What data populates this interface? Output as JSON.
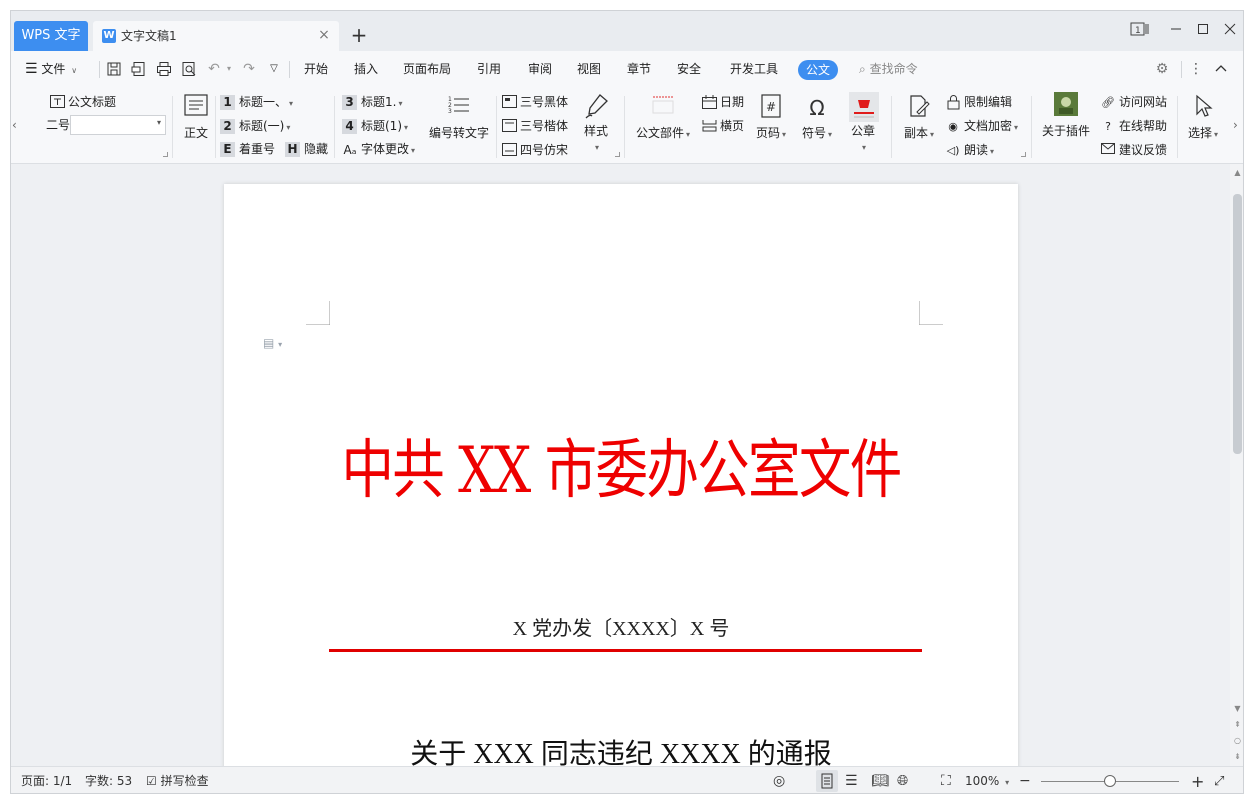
{
  "tabs": {
    "app_label": "WPS 文字",
    "doc_label": "文字文稿1",
    "doc_icon": "W",
    "close": "×",
    "new": "+"
  },
  "window": {
    "page_indicator": "1"
  },
  "menu": {
    "file_label": "文件",
    "items": [
      "开始",
      "插入",
      "页面布局",
      "引用",
      "审阅",
      "视图",
      "章节",
      "安全",
      "开发工具"
    ],
    "active": "公文",
    "search": "查找命令"
  },
  "ribbon": {
    "official_title": "公文标题",
    "font_size_label": "二号",
    "body_text": "正文",
    "heading1": "标题一、",
    "heading2": "标题(一)",
    "heading3": "标题1.",
    "heading4": "标题(1)",
    "h1_num": "1",
    "h2_num": "2",
    "h3_num": "3",
    "h4_num": "4",
    "emphasis": "着重号",
    "hide": "隐藏",
    "font_change": "字体更改",
    "num_to_text": "编号转文字",
    "font_hei": "三号黑体",
    "font_kai": "三号楷体",
    "font_fang": "四号仿宋",
    "style": "样式",
    "doc_parts": "公文部件",
    "date": "日期",
    "landscape": "横页",
    "page_num": "页码",
    "symbol": "符号",
    "seal": "公章",
    "copy": "副本",
    "restrict_edit": "限制编辑",
    "encrypt": "文档加密",
    "read_aloud": "朗读",
    "about_plugin": "关于插件",
    "visit_site": "访问网站",
    "online_help": "在线帮助",
    "feedback": "建议反馈",
    "select": "选择"
  },
  "document": {
    "title": "中共 XX 市委办公室文件",
    "doc_number": "X 党办发〔XXXX〕X 号",
    "subject": "关于 XXX 同志违纪 XXXX 的通报"
  },
  "status": {
    "page": "页面: 1/1",
    "word_count": "字数: 53",
    "spell_check": "拼写检查",
    "zoom": "100%"
  },
  "colors": {
    "accent": "#3d8ef0",
    "title_red": "#ee0000"
  }
}
